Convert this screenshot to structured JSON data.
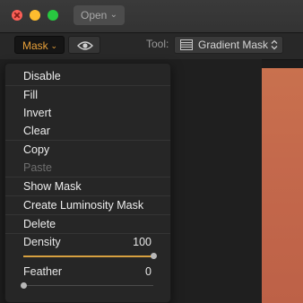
{
  "window": {
    "open_button_label": "Open",
    "accent_color": "#e8a13a"
  },
  "toolbar": {
    "mask_button_label": "Mask",
    "tool_label": "Tool:",
    "tool_value": "Gradient Mask"
  },
  "menu": {
    "items": [
      {
        "label": "Disable",
        "enabled": true
      },
      {
        "label": "Fill",
        "enabled": true
      },
      {
        "label": "Invert",
        "enabled": true
      },
      {
        "label": "Clear",
        "enabled": true
      },
      {
        "label": "Copy",
        "enabled": true
      },
      {
        "label": "Paste",
        "enabled": false
      },
      {
        "label": "Show Mask",
        "enabled": true
      },
      {
        "label": "Create Luminosity Mask",
        "enabled": true
      },
      {
        "label": "Delete",
        "enabled": true
      }
    ],
    "density": {
      "label": "Density",
      "value": "100",
      "fraction": 1.0
    },
    "feather": {
      "label": "Feather",
      "value": "0",
      "fraction": 0.0
    }
  }
}
